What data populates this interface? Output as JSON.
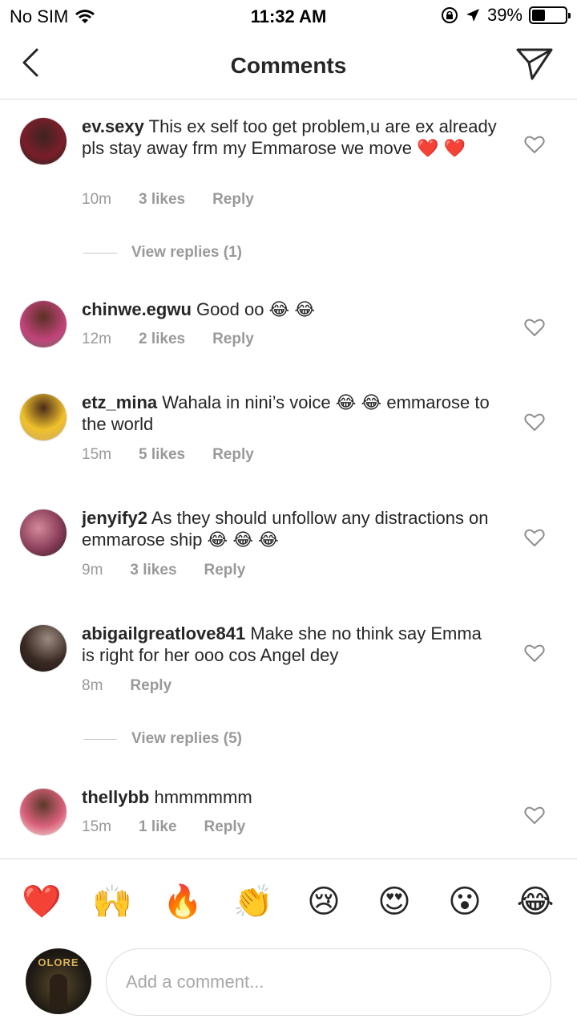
{
  "status_bar": {
    "carrier": "No SIM",
    "time": "11:32 AM",
    "battery": "39%",
    "battery_level": 0.39
  },
  "nav": {
    "title": "Comments"
  },
  "comments": [
    {
      "username": "ev.sexy",
      "text": "This ex self too get problem,u are ex already pls stay away frm my Emmarose we move ❤️ ❤️",
      "time": "10m",
      "likes": "3 likes",
      "reply": "Reply",
      "view_replies": "View replies (1)",
      "avatar_color": "#7a1e2a"
    },
    {
      "username": "chinwe.egwu",
      "text": "Good oo 😂 😂",
      "time": "12m",
      "likes": "2 likes",
      "reply": "Reply",
      "avatar_color": "#c1447a"
    },
    {
      "username": "etz_mina",
      "text": "Wahala in nini’s voice 😂 😂 emmarose to the world",
      "time": "15m",
      "likes": "5 likes",
      "reply": "Reply",
      "avatar_color": "#f0c12a"
    },
    {
      "username": "jenyify2",
      "text": "As they should unfollow any distractions on emmarose ship 😂 😂 😂",
      "time": "9m",
      "likes": "3 likes",
      "reply": "Reply",
      "avatar_color": "#8a3e5a"
    },
    {
      "username": "abigailgreatlove841",
      "text": "Make she no think say Emma is right for her ooo cos Angel dey",
      "time": "8m",
      "likes": "",
      "reply": "Reply",
      "view_replies": "View replies (5)",
      "avatar_color": "#3a2a24"
    },
    {
      "username": "thellybb",
      "text": "hmmmmmm",
      "time": "15m",
      "likes": "1 like",
      "reply": "Reply",
      "avatar_color": "#d9607a"
    }
  ],
  "emoji_bar": [
    "❤️",
    "🙌",
    "🔥",
    "👏",
    "😢",
    "😍",
    "😮",
    "😂"
  ],
  "input": {
    "placeholder": "Add a comment...",
    "avatar_text": "OLORE"
  }
}
